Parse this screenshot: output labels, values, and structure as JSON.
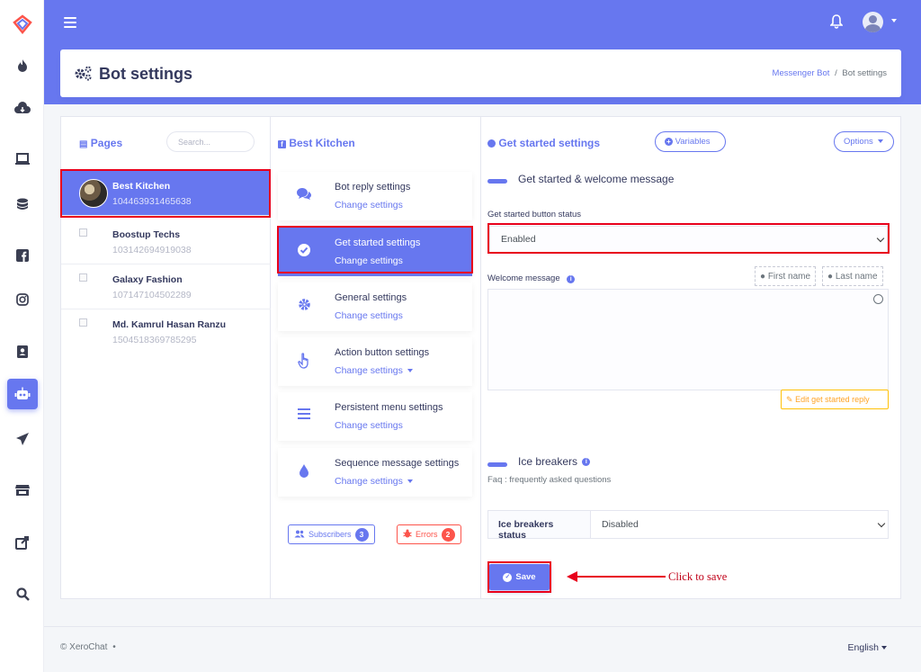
{
  "header": {
    "title": "Bot settings",
    "breadcrumb": {
      "link": "Messenger Bot",
      "separator": "/",
      "current": "Bot settings"
    }
  },
  "sidebar": {
    "icons": [
      "logo-icon",
      "fire-icon",
      "cloud-download-icon",
      "laptop-icon",
      "database-icon",
      "facebook-icon",
      "instagram-icon",
      "contacts-icon",
      "robot-icon",
      "paper-plane-icon",
      "store-icon",
      "share-icon",
      "search-icon"
    ],
    "active_icon": "robot-icon"
  },
  "pages_panel": {
    "heading": "Pages",
    "search_placeholder": "Search...",
    "pages": [
      {
        "name": "Best Kitchen",
        "id": "104463931465638"
      },
      {
        "name": "Boostup Techs",
        "id": "103142694919038"
      },
      {
        "name": "Galaxy Fashion",
        "id": "107147104502289"
      },
      {
        "name": "Md. Kamrul Hasan Ranzu",
        "id": "1504518369785295"
      }
    ]
  },
  "settings_panel": {
    "heading": "Best Kitchen",
    "items": [
      {
        "title": "Bot reply settings",
        "sub": "Change settings",
        "icon": "comments-icon"
      },
      {
        "title": "Get started settings",
        "sub": "Change settings",
        "icon": "check-circle-icon"
      },
      {
        "title": "General settings",
        "sub": "Change settings",
        "icon": "gear-icon"
      },
      {
        "title": "Action button settings",
        "sub": "Change settings",
        "icon": "hand-pointer-icon"
      },
      {
        "title": "Persistent menu settings",
        "sub": "Change settings",
        "icon": "bars-icon"
      },
      {
        "title": "Sequence message settings",
        "sub": "Change settings",
        "icon": "tint-icon"
      }
    ],
    "subscribers_label": "Subscribers",
    "subscribers_count": "3",
    "errors_label": "Errors",
    "errors_count": "2"
  },
  "get_started": {
    "heading": "Get started settings",
    "variables_label": "Variables",
    "options_label": "Options",
    "section1_title": "Get started & welcome message",
    "status_label": "Get started button status",
    "status_value": "Enabled",
    "welcome_label": "Welcome message",
    "first_name_label": "First name",
    "last_name_label": "Last name",
    "edit_reply_label": "Edit get started reply",
    "ice_title": "Ice breakers",
    "ice_sub": "Faq : frequently asked questions",
    "ice_status_label": "Ice breakers status",
    "ice_status_value": "Disabled",
    "save_label": "Save"
  },
  "annotation": {
    "text": "Click to save"
  },
  "footer": {
    "copyright": "© XeroChat",
    "bullet": "•",
    "language": "English"
  },
  "colors": {
    "primary": "#6777ef",
    "danger": "#fc544b",
    "warning": "#ffa426",
    "highlight": "#e8001c"
  }
}
